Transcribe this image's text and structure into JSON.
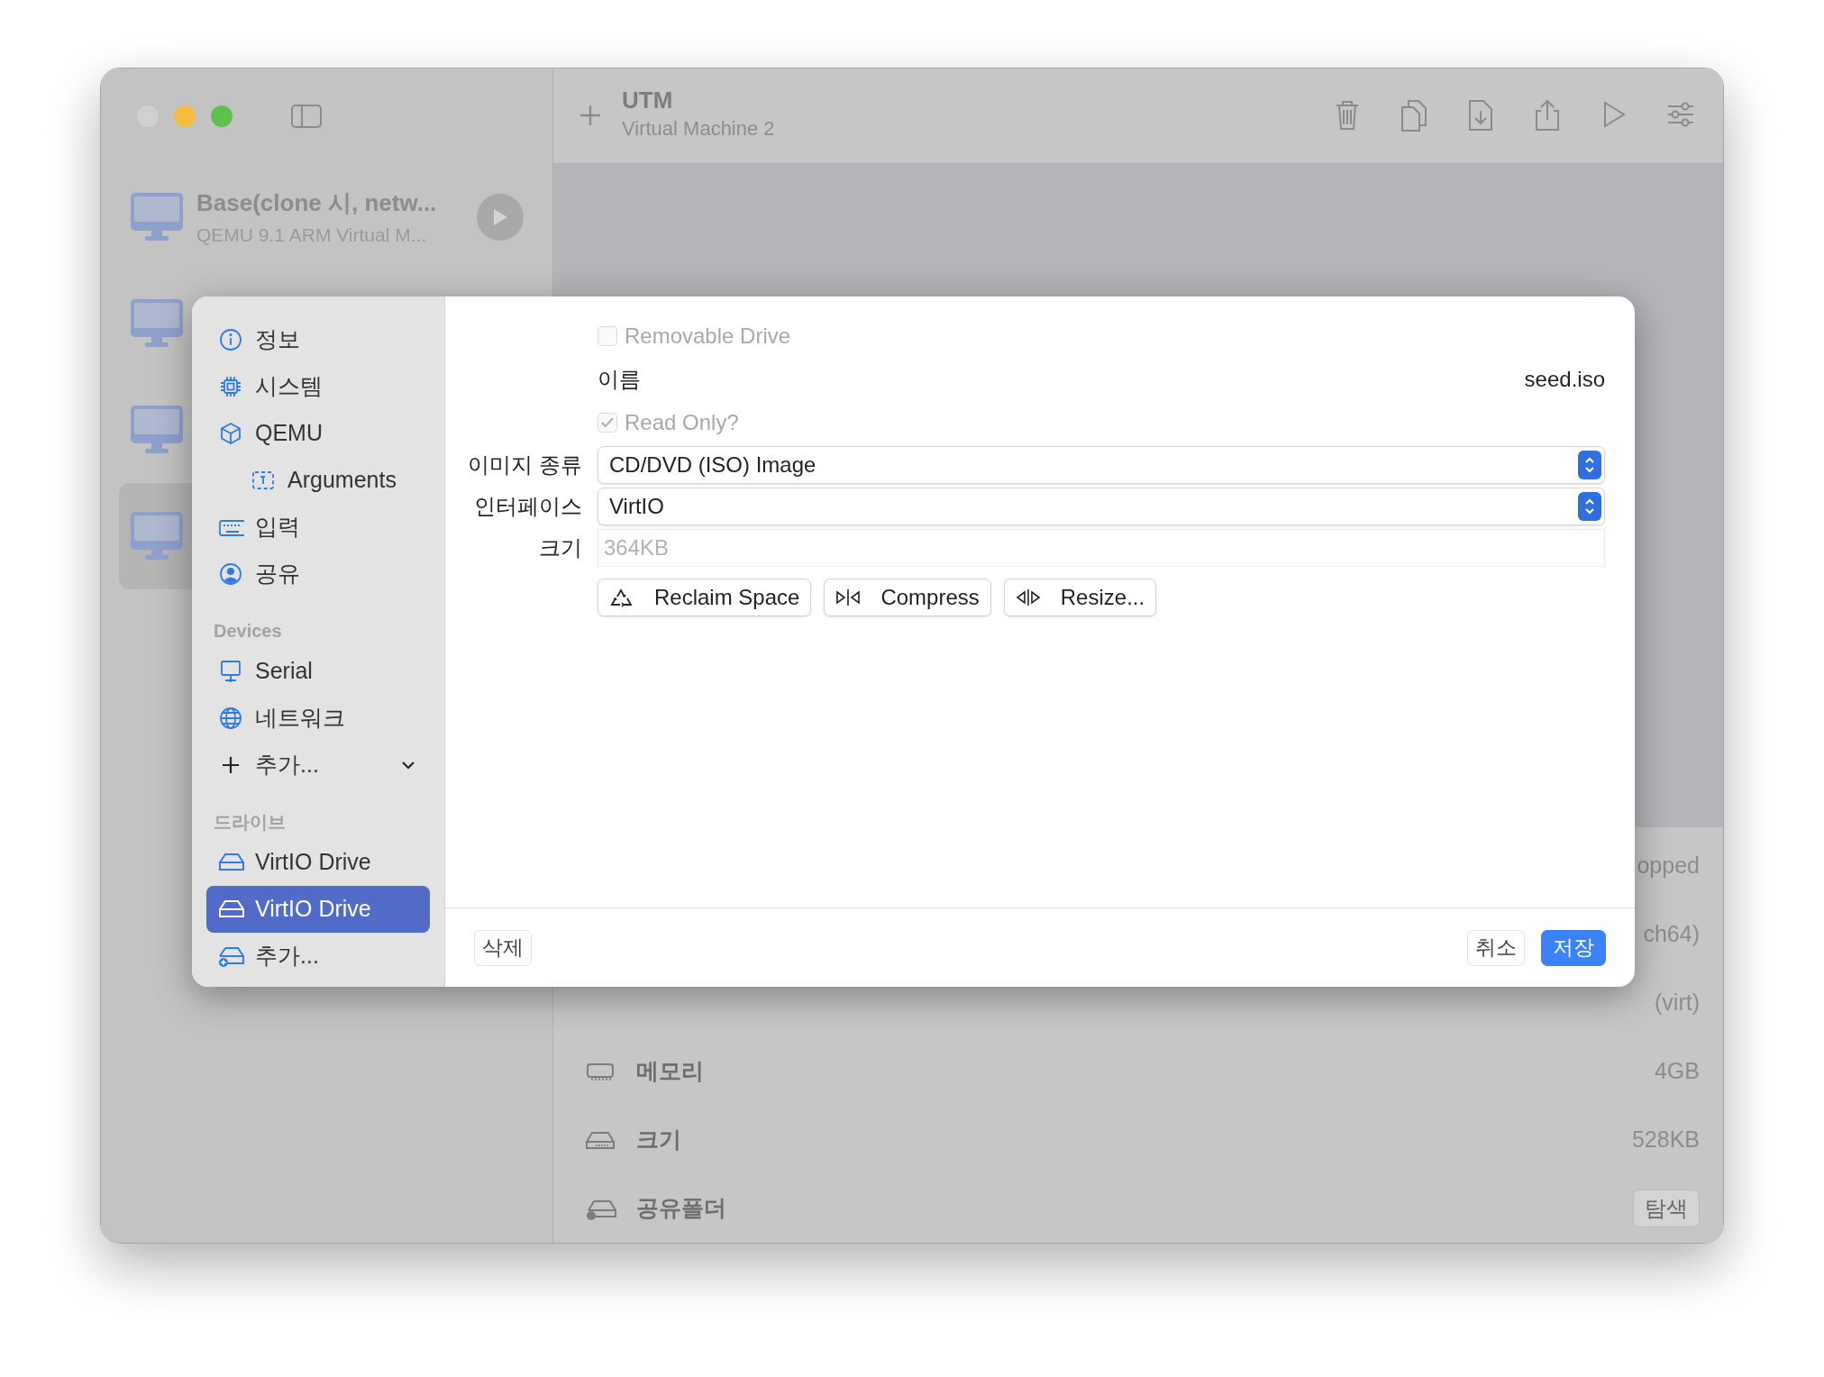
{
  "window": {
    "title": "UTM",
    "subtitle": "Virtual Machine 2"
  },
  "vm_list": [
    {
      "name": "Base(clone 시, netw...",
      "subtitle": "QEMU 9.1 ARM Virtual M...",
      "selected": false
    },
    {
      "selected": false
    },
    {
      "selected": false
    },
    {
      "selected": true
    }
  ],
  "details": [
    {
      "value": "opped"
    },
    {
      "value": "ch64)"
    },
    {
      "value": "(virt)"
    },
    {
      "kind": "memory",
      "label": "메모리",
      "value": "4GB"
    },
    {
      "kind": "drive",
      "label": "크기",
      "value": "528KB"
    },
    {
      "kind": "shared",
      "label": "공유폴더",
      "button": "탐색"
    }
  ],
  "settings": {
    "sections": [
      {
        "items": [
          {
            "kind": "info",
            "label": "정보",
            "selected": false
          },
          {
            "kind": "system",
            "label": "시스템",
            "selected": false
          },
          {
            "kind": "qemu",
            "label": "QEMU",
            "selected": false,
            "children": [
              {
                "kind": "arguments",
                "label": "Arguments",
                "selected": false
              }
            ]
          },
          {
            "kind": "input",
            "label": "입력",
            "selected": false
          },
          {
            "kind": "sharing",
            "label": "공유",
            "selected": false
          }
        ]
      },
      {
        "header": "Devices",
        "items": [
          {
            "kind": "serial",
            "label": "Serial",
            "selected": false
          },
          {
            "kind": "network",
            "label": "네트워크",
            "selected": false
          },
          {
            "kind": "add",
            "label": "추가...",
            "selected": false
          }
        ]
      },
      {
        "header": "드라이브",
        "items": [
          {
            "kind": "drive",
            "label": "VirtIO Drive",
            "selected": false
          },
          {
            "kind": "drive",
            "label": "VirtIO Drive",
            "selected": true
          },
          {
            "kind": "add_drive",
            "label": "추가...",
            "selected": false
          }
        ]
      }
    ],
    "form": {
      "removable": {
        "label": "Removable Drive",
        "checked": false,
        "disabled": true
      },
      "name": {
        "label": "이름",
        "value": "seed.iso"
      },
      "read_only": {
        "label": "Read Only?",
        "checked": true,
        "disabled": true
      },
      "image_type": {
        "label": "이미지 종류",
        "value": "CD/DVD (ISO) Image"
      },
      "interface": {
        "label": "인터페이스",
        "value": "VirtIO"
      },
      "size": {
        "label": "크기",
        "value": "364KB",
        "disabled": true
      },
      "actions": [
        {
          "kind": "reclaim",
          "label": "Reclaim Space"
        },
        {
          "kind": "compress",
          "label": "Compress"
        },
        {
          "kind": "resize",
          "label": "Resize..."
        }
      ]
    },
    "footer": {
      "delete": "삭제",
      "cancel": "취소",
      "save": "저장"
    }
  }
}
